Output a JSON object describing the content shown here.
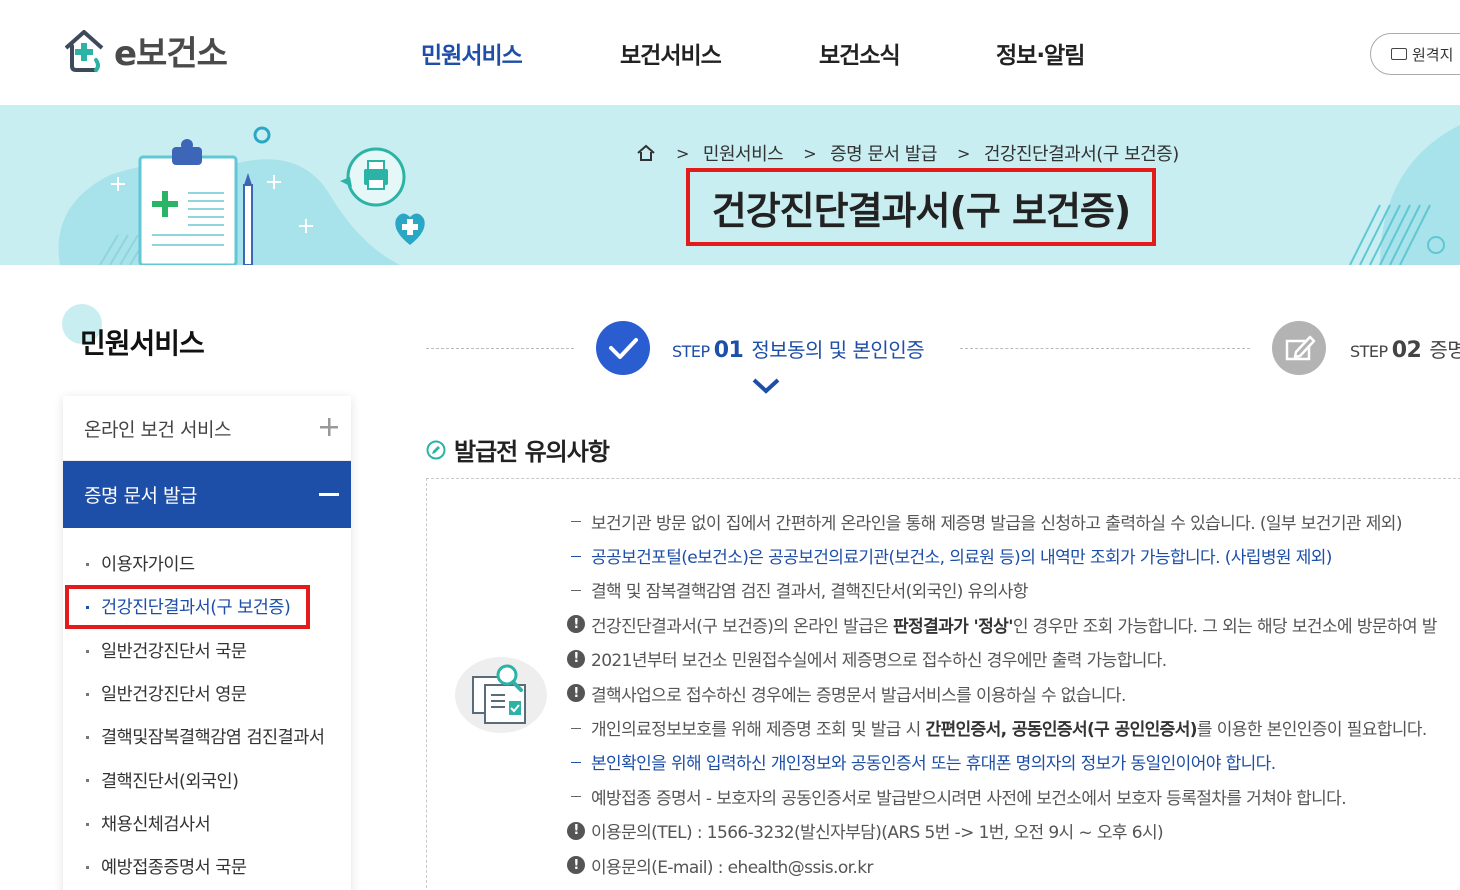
{
  "header": {
    "logo_text": "e보건소",
    "nav": [
      "민원서비스",
      "보건서비스",
      "보건소식",
      "정보·알림"
    ],
    "remote_label": "원격지"
  },
  "banner": {
    "breadcrumb": [
      "민원서비스",
      "증명 문서 발급",
      "건강진단결과서(구 보건증)"
    ],
    "title": "건강진단결과서(구 보건증)"
  },
  "sidebar": {
    "title": "민원서비스",
    "menu1": "온라인 보건 서비스",
    "menu2": "증명 문서 발급",
    "sub_items": [
      "이용자가이드",
      "건강진단결과서(구 보건증)",
      "일반건강진단서 국문",
      "일반건강진단서 영문",
      "결핵및잠복결핵감염 검진결과서",
      "결핵진단서(외국인)",
      "채용신체검사서",
      "예방접종증명서 국문"
    ],
    "active_index": 1
  },
  "steps": {
    "step1": {
      "prefix": "STEP",
      "num": "01",
      "title": "정보동의 및 본인인증"
    },
    "step2": {
      "prefix": "STEP",
      "num": "02",
      "title": "증명"
    }
  },
  "section": {
    "title": "발급전 유의사항"
  },
  "notices": [
    {
      "type": "dash",
      "color": "gray",
      "text": "보건기관 방문 없이 집에서 간편하게 온라인을 통해 제증명 발급을 신청하고 출력하실 수 있습니다. (일부 보건기관 제외)"
    },
    {
      "type": "dash",
      "color": "blue",
      "text": "공공보건포털(e보건소)은 공공보건의료기관(보건소, 의료원 등)의 내역만 조회가 가능합니다. (사립병원 제외)"
    },
    {
      "type": "dash",
      "color": "gray",
      "text": "결핵 및 잠복결핵감염 검진 결과서, 결핵진단서(외국인) 유의사항"
    },
    {
      "type": "warn",
      "color": "gray",
      "pre": "건강진단결과서(구 보건증)의 온라인 발급은 ",
      "bold": "판정결과가 '정상'",
      "post": "인 경우만 조회 가능합니다. 그 외는 해당 보건소에 방문하여 발"
    },
    {
      "type": "warn",
      "color": "gray",
      "text": "2021년부터 보건소 민원접수실에서 제증명으로 접수하신 경우에만 출력 가능합니다."
    },
    {
      "type": "warn",
      "color": "gray",
      "text": "결핵사업으로 접수하신 경우에는 증명문서 발급서비스를 이용하실 수 없습니다."
    },
    {
      "type": "dash",
      "color": "gray",
      "pre": "개인의료정보보호를 위해 제증명 조회 및 발급 시 ",
      "bold": "간편인증서, 공동인증서(구 공인인증서)",
      "post": "를 이용한 본인인증이 필요합니다."
    },
    {
      "type": "dash",
      "color": "blue",
      "text": "본인확인을 위해 입력하신 개인정보와 공동인증서 또는 휴대폰 명의자의 정보가 동일인이어야 합니다."
    },
    {
      "type": "dash",
      "color": "gray",
      "text": "예방접종 증명서 - 보호자의 공동인증서로 발급받으시려면 사전에 보건소에서 보호자 등록절차를 거쳐야 합니다."
    },
    {
      "type": "warn",
      "color": "gray",
      "text": "이용문의(TEL) : 1566-3232(발신자부담)(ARS 5번 -> 1번, 오전 9시 ~ 오후 6시)"
    },
    {
      "type": "warn",
      "color": "gray",
      "text": "이용문의(E-mail) : ehealth@ssis.or.kr"
    }
  ]
}
